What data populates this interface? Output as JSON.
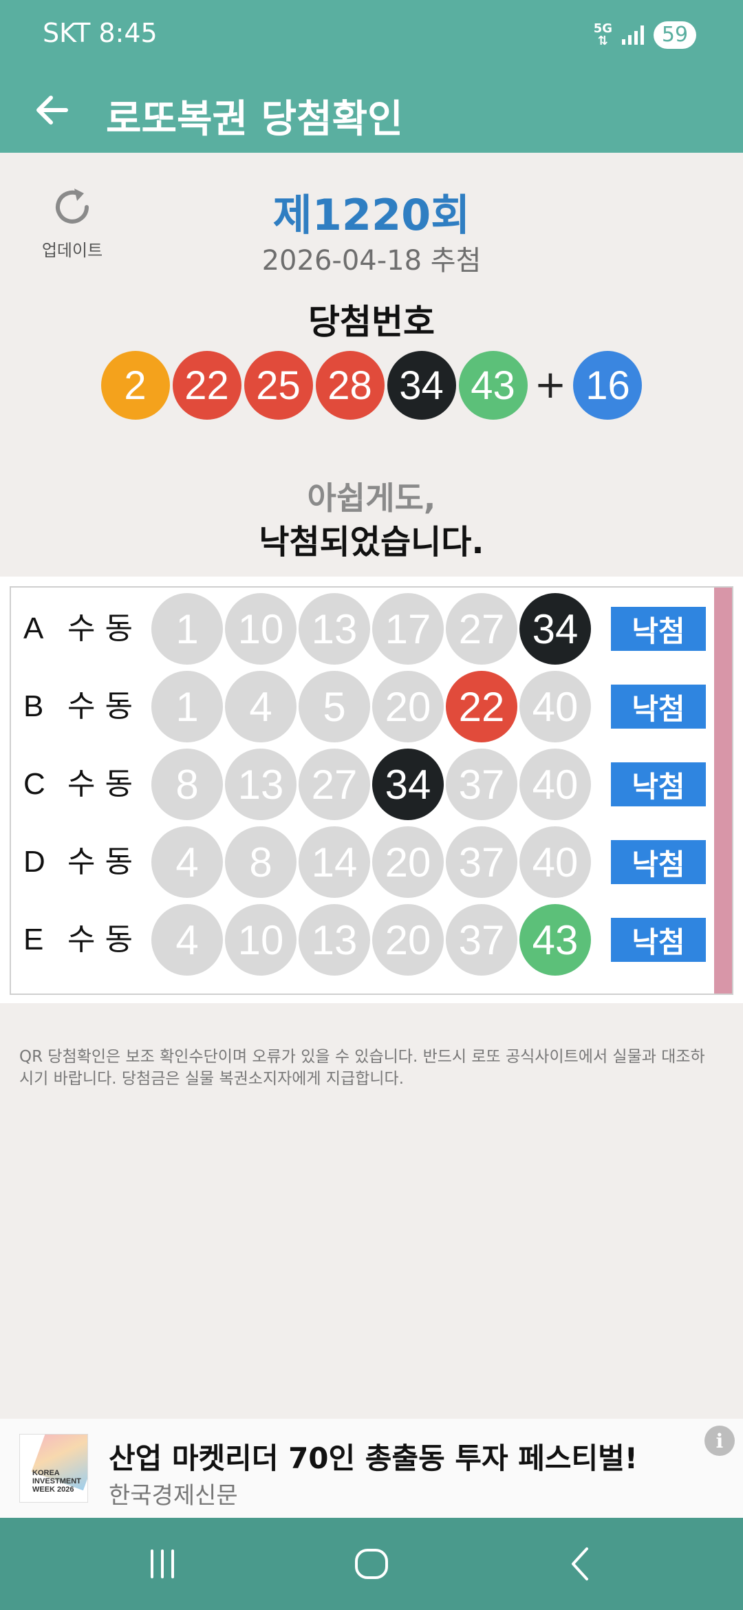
{
  "status": {
    "carrier_time": "SKT 8:45",
    "network": "5G",
    "battery": "59"
  },
  "app_bar": {
    "title": "로또복권 당첨확인",
    "back_icon": "arrow-left-icon"
  },
  "header": {
    "refresh_label": "업데이트",
    "round": "제1220회",
    "draw_date": "2026-04-18 추첨",
    "winning_label": "당첨번호",
    "plus": "+",
    "message_line1": "아쉽게도,",
    "message_line2": "낙첨되었습니다."
  },
  "winning_numbers": [
    {
      "value": "2",
      "color": "#f4a21c"
    },
    {
      "value": "22",
      "color": "#e14b3b"
    },
    {
      "value": "25",
      "color": "#e14b3b"
    },
    {
      "value": "28",
      "color": "#e14b3b"
    },
    {
      "value": "34",
      "color": "#1e2224"
    },
    {
      "value": "43",
      "color": "#5cc079"
    }
  ],
  "bonus_number": {
    "value": "16",
    "color": "#3a86e0"
  },
  "tickets": [
    {
      "letter": "A",
      "mode": "수동",
      "result": "낙첨",
      "numbers": [
        {
          "value": "1",
          "color": ""
        },
        {
          "value": "10",
          "color": ""
        },
        {
          "value": "13",
          "color": ""
        },
        {
          "value": "17",
          "color": ""
        },
        {
          "value": "27",
          "color": ""
        },
        {
          "value": "34",
          "color": "#1e2224"
        }
      ]
    },
    {
      "letter": "B",
      "mode": "수동",
      "result": "낙첨",
      "numbers": [
        {
          "value": "1",
          "color": ""
        },
        {
          "value": "4",
          "color": ""
        },
        {
          "value": "5",
          "color": ""
        },
        {
          "value": "20",
          "color": ""
        },
        {
          "value": "22",
          "color": "#e14b3b"
        },
        {
          "value": "40",
          "color": ""
        }
      ]
    },
    {
      "letter": "C",
      "mode": "수동",
      "result": "낙첨",
      "numbers": [
        {
          "value": "8",
          "color": ""
        },
        {
          "value": "13",
          "color": ""
        },
        {
          "value": "27",
          "color": ""
        },
        {
          "value": "34",
          "color": "#1e2224"
        },
        {
          "value": "37",
          "color": ""
        },
        {
          "value": "40",
          "color": ""
        }
      ]
    },
    {
      "letter": "D",
      "mode": "수동",
      "result": "낙첨",
      "numbers": [
        {
          "value": "4",
          "color": ""
        },
        {
          "value": "8",
          "color": ""
        },
        {
          "value": "14",
          "color": ""
        },
        {
          "value": "20",
          "color": ""
        },
        {
          "value": "37",
          "color": ""
        },
        {
          "value": "40",
          "color": ""
        }
      ]
    },
    {
      "letter": "E",
      "mode": "수동",
      "result": "낙첨",
      "numbers": [
        {
          "value": "4",
          "color": ""
        },
        {
          "value": "10",
          "color": ""
        },
        {
          "value": "13",
          "color": ""
        },
        {
          "value": "20",
          "color": ""
        },
        {
          "value": "37",
          "color": ""
        },
        {
          "value": "43",
          "color": "#5cc079"
        }
      ]
    }
  ],
  "notice": "QR 당첨확인은 보조 확인수단이며 오류가 있을 수 있습니다. 반드시 로또 공식사이트에서 실물과 대조하시기 바랍니다. 당첨금은 실물 복권소지자에게 지급합니다.",
  "ad": {
    "thumb_text": "KOREA INVESTMENT WEEK 2026",
    "title": "산업 마켓리더 70인 총출동 투자 페스티벌!",
    "source": "한국경제신문",
    "info": "i"
  },
  "colors": {
    "theme": "#5aafa0",
    "nav": "#4a9a8c",
    "button": "#2f85e0",
    "miss_ball": "#d9d9d9"
  }
}
